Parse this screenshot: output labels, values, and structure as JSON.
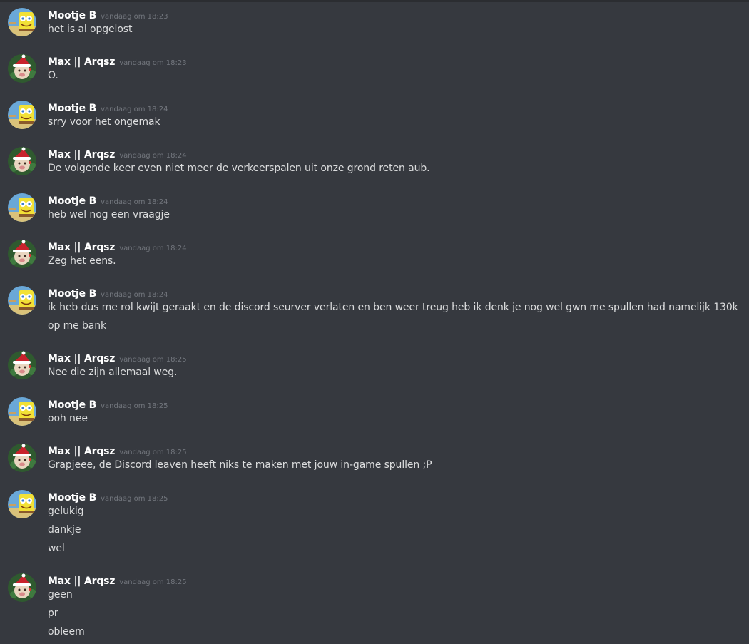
{
  "users": {
    "mootje": {
      "name": "Mootje B",
      "avatar_icon": "spongebob-avatar-icon"
    },
    "max": {
      "name": "Max || Arqsz",
      "avatar_icon": "santa-hat-avatar-icon"
    }
  },
  "messages": [
    {
      "author": "Mootje B",
      "time": "vandaag om 18:23",
      "lines": [
        "het is al opgelost"
      ]
    },
    {
      "author": "Max || Arqsz",
      "time": "vandaag om 18:23",
      "lines": [
        "O."
      ]
    },
    {
      "author": "Mootje B",
      "time": "vandaag om 18:24",
      "lines": [
        "srry voor het ongemak"
      ]
    },
    {
      "author": "Max || Arqsz",
      "time": "vandaag om 18:24",
      "lines": [
        "De volgende keer even niet meer de verkeerspalen uit onze grond reten aub."
      ]
    },
    {
      "author": "Mootje B",
      "time": "vandaag om 18:24",
      "lines": [
        "heb wel nog een vraagje"
      ]
    },
    {
      "author": "Max || Arqsz",
      "time": "vandaag om 18:24",
      "lines": [
        "Zeg het eens."
      ]
    },
    {
      "author": "Mootje B",
      "time": "vandaag om 18:24",
      "lines": [
        "ik heb dus me rol kwijt geraakt en de discord seurver verlaten en ben weer treug heb ik denk je nog wel gwn me spullen had namelijk 130k",
        "op me bank"
      ]
    },
    {
      "author": "Max || Arqsz",
      "time": "vandaag om 18:25",
      "lines": [
        "Nee die zijn allemaal weg."
      ]
    },
    {
      "author": "Mootje B",
      "time": "vandaag om 18:25",
      "lines": [
        "ooh nee"
      ]
    },
    {
      "author": "Max || Arqsz",
      "time": "vandaag om 18:25",
      "lines": [
        "Grapjeee, de Discord leaven heeft niks te maken met jouw in-game spullen ;P"
      ]
    },
    {
      "author": "Mootje B",
      "time": "vandaag om 18:25",
      "lines": [
        "gelukig",
        "dankje",
        "wel"
      ]
    },
    {
      "author": "Max || Arqsz",
      "time": "vandaag om 18:25",
      "lines": [
        "geen",
        "pr",
        "obleem"
      ]
    }
  ],
  "colors": {
    "background": "#36393f",
    "username": "#ffffff",
    "timestamp": "#72767d",
    "text": "#dcddde"
  }
}
